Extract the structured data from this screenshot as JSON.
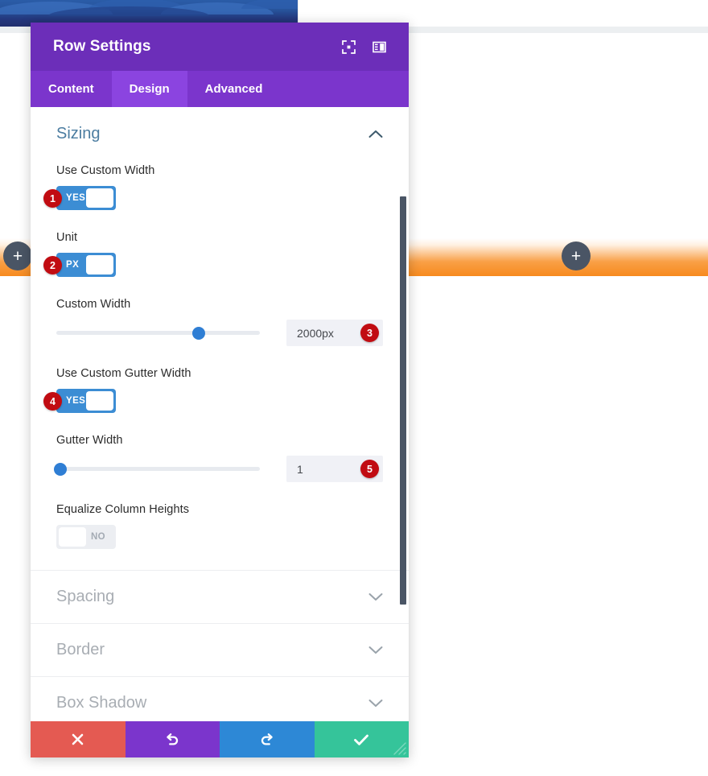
{
  "background": {
    "hero_alt": "dark-blue-wave-banner",
    "left_add_button": "+",
    "right_add_button": "+",
    "orange_band_color": "#f78a1e"
  },
  "modal": {
    "title": "Row Settings",
    "header_icons": [
      {
        "name": "expand-view-icon",
        "glyph": "expand"
      },
      {
        "name": "layout-panel-icon",
        "glyph": "panel"
      }
    ],
    "tabs": [
      {
        "label": "Content",
        "active": false
      },
      {
        "label": "Design",
        "active": true
      },
      {
        "label": "Advanced",
        "active": false
      }
    ],
    "sections_open": [
      {
        "title": "Sizing",
        "expanded": true
      }
    ],
    "fields": [
      {
        "label": "Use Custom Width",
        "type": "toggle",
        "value": "YES",
        "state": "on",
        "badge": "1"
      },
      {
        "label": "Unit",
        "type": "toggle",
        "value": "PX",
        "state": "on",
        "badge": "2"
      },
      {
        "label": "Custom Width",
        "type": "slider",
        "value": "2000px",
        "slider_percent": 70,
        "badge": "3"
      },
      {
        "label": "Use Custom Gutter Width",
        "type": "toggle",
        "value": "YES",
        "state": "on",
        "badge": "4"
      },
      {
        "label": "Gutter Width",
        "type": "slider",
        "value": "1",
        "slider_percent": 2,
        "badge": "5"
      },
      {
        "label": "Equalize Column Heights",
        "type": "toggle",
        "value": "NO",
        "state": "off",
        "badge": ""
      }
    ],
    "sections_closed": [
      {
        "title": "Spacing"
      },
      {
        "title": "Border"
      },
      {
        "title": "Box Shadow"
      }
    ],
    "footer_buttons": [
      {
        "name": "cancel-button",
        "icon": "close-icon",
        "color": "#e45a52"
      },
      {
        "name": "undo-button",
        "icon": "undo-icon",
        "color": "#7b35cc"
      },
      {
        "name": "redo-button",
        "icon": "redo-icon",
        "color": "#2d88d6"
      },
      {
        "name": "save-button",
        "icon": "checkmark-icon",
        "color": "#35c49a"
      }
    ]
  }
}
